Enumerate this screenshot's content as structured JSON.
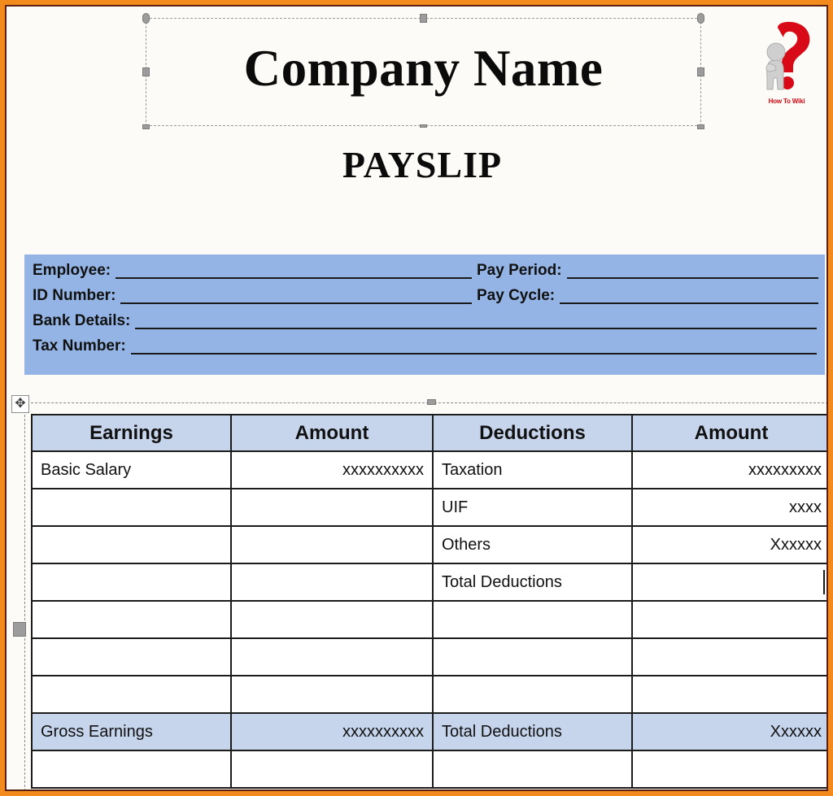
{
  "document": {
    "company_name": "Company Name",
    "payslip_heading": "PAYSLIP"
  },
  "logo": {
    "caption": "How To Wiki",
    "mark_color": "#D60812",
    "figure_color": "#C8C8C8",
    "icon_name": "question-mark-logo"
  },
  "frame": {
    "outer_color": "#F28A1E",
    "inner_line_color": "#5C2110"
  },
  "info_panel": {
    "background_color": "#93B4E5",
    "fields": [
      {
        "label": "Employee:",
        "value": ""
      },
      {
        "label": "ID Number:",
        "value": ""
      },
      {
        "label": "Bank Details:",
        "value": ""
      },
      {
        "label": "Tax Number:",
        "value": ""
      },
      {
        "label": "Pay Period:",
        "value": ""
      },
      {
        "label": "Pay Cycle:",
        "value": ""
      }
    ]
  },
  "table": {
    "header_background": "#C6D5EC",
    "headers": [
      "Earnings",
      "Amount",
      "Deductions",
      "Amount"
    ],
    "rows": [
      {
        "earnings": "Basic Salary",
        "earnings_amount": "xxxxxxxxxx",
        "deductions": "Taxation",
        "deductions_amount": "xxxxxxxxx",
        "highlight": false,
        "caret": false
      },
      {
        "earnings": "",
        "earnings_amount": "",
        "deductions": "UIF",
        "deductions_amount": "xxxx",
        "highlight": false,
        "caret": false
      },
      {
        "earnings": "",
        "earnings_amount": "",
        "deductions": "Others",
        "deductions_amount": "Xxxxxx",
        "highlight": false,
        "caret": false
      },
      {
        "earnings": "",
        "earnings_amount": "",
        "deductions": "Total Deductions",
        "deductions_amount": "",
        "highlight": false,
        "caret": true
      },
      {
        "earnings": "",
        "earnings_amount": "",
        "deductions": "",
        "deductions_amount": "",
        "highlight": false,
        "caret": false
      },
      {
        "earnings": "",
        "earnings_amount": "",
        "deductions": "",
        "deductions_amount": "",
        "highlight": false,
        "caret": false
      },
      {
        "earnings": "",
        "earnings_amount": "",
        "deductions": "",
        "deductions_amount": "",
        "highlight": false,
        "caret": false
      },
      {
        "earnings": "Gross Earnings",
        "earnings_amount": "xxxxxxxxxx",
        "deductions": "Total Deductions",
        "deductions_amount": "Xxxxxx",
        "highlight": true,
        "caret": false
      },
      {
        "earnings": "",
        "earnings_amount": "",
        "deductions": "",
        "deductions_amount": "",
        "highlight": false,
        "caret": false
      }
    ]
  },
  "selection": {
    "title_selected": true,
    "table_move_handle_glyph": "✥"
  }
}
